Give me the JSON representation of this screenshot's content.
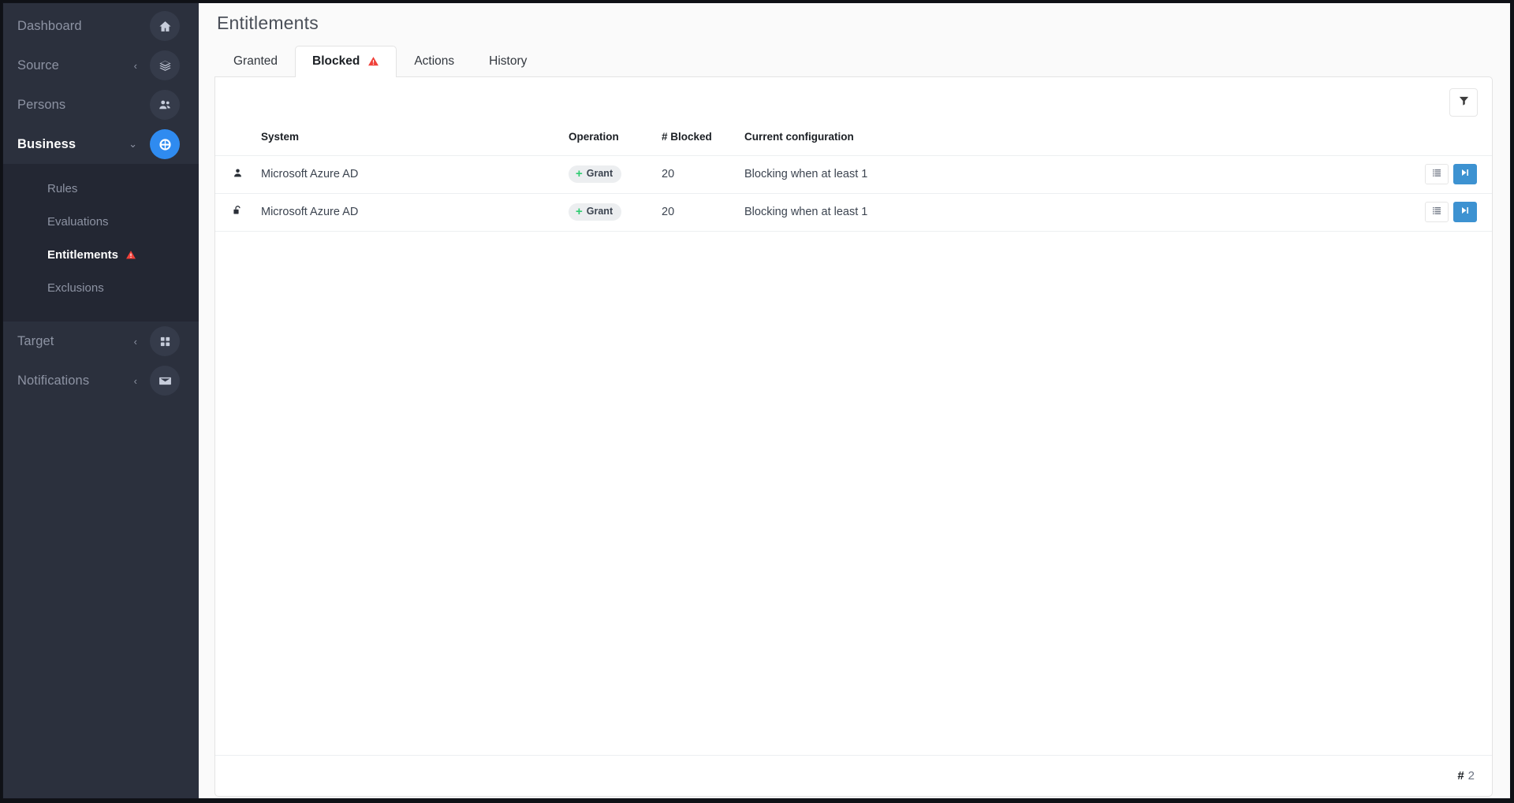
{
  "sidebar": {
    "items": [
      {
        "label": "Dashboard",
        "icon": "home-icon",
        "caret": "",
        "active": false
      },
      {
        "label": "Source",
        "icon": "layers-icon",
        "caret": "‹",
        "active": false
      },
      {
        "label": "Persons",
        "icon": "people-icon",
        "caret": "",
        "active": false
      },
      {
        "label": "Business",
        "icon": "business-icon",
        "caret": "⌄",
        "active": true
      },
      {
        "label": "Target",
        "icon": "grid-icon",
        "caret": "‹",
        "active": false
      },
      {
        "label": "Notifications",
        "icon": "envelope-icon",
        "caret": "‹",
        "active": false
      }
    ],
    "submenu": [
      {
        "label": "Rules",
        "warning": false,
        "active": false
      },
      {
        "label": "Evaluations",
        "warning": false,
        "active": false
      },
      {
        "label": "Entitlements",
        "warning": true,
        "active": true
      },
      {
        "label": "Exclusions",
        "warning": false,
        "active": false
      }
    ]
  },
  "page": {
    "title": "Entitlements"
  },
  "tabs": [
    {
      "label": "Granted",
      "warning": false,
      "active": false
    },
    {
      "label": "Blocked",
      "warning": true,
      "active": true
    },
    {
      "label": "Actions",
      "warning": false,
      "active": false
    },
    {
      "label": "History",
      "warning": false,
      "active": false
    }
  ],
  "toolbar": {
    "filter_icon": "filter-icon"
  },
  "table": {
    "columns": [
      "",
      "System",
      "Operation",
      "# Blocked",
      "Current configuration",
      ""
    ],
    "rows": [
      {
        "type_icon": "user-icon",
        "system": "Microsoft Azure AD",
        "operation": "Grant",
        "operation_prefix": "+",
        "blocked": "20",
        "configuration": "Blocking when at least 1",
        "actions": [
          "list-icon",
          "skip-forward-icon"
        ]
      },
      {
        "type_icon": "unlock-icon",
        "system": "Microsoft Azure AD",
        "operation": "Grant",
        "operation_prefix": "+",
        "blocked": "20",
        "configuration": "Blocking when at least 1",
        "actions": [
          "list-icon",
          "skip-forward-icon"
        ]
      }
    ]
  },
  "footer": {
    "hash": "#",
    "count": "2"
  },
  "colors": {
    "sidebar_bg": "#2b303d",
    "submenu_bg": "#232733",
    "accent": "#2f8bf0",
    "primary_button": "#3d92d1",
    "warning": "#f0413a",
    "grant_plus": "#2ecc71",
    "badge_bg": "#eceef0"
  }
}
